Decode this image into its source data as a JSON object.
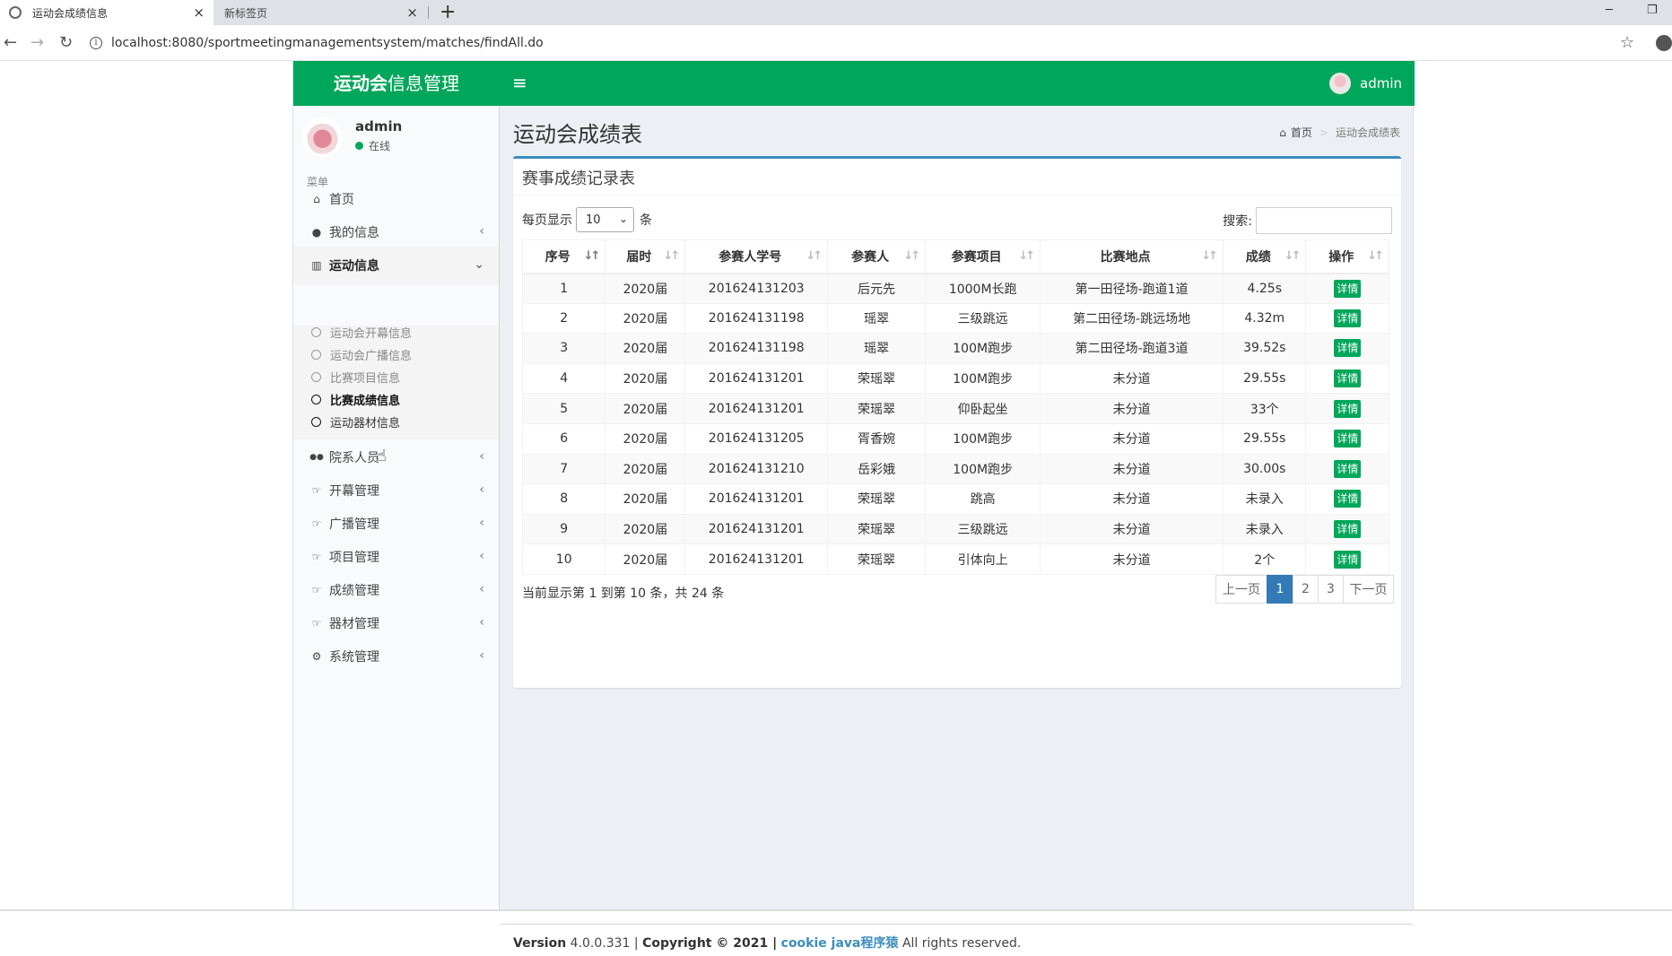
{
  "browser": {
    "tabs": [
      {
        "title": "运动会成绩信息",
        "close": "×"
      },
      {
        "title": "新标签页",
        "close": "×"
      }
    ],
    "new_tab": "+",
    "url": "localhost:8080/sportmeetingmanagementsystem/matches/findAll.do",
    "back": "←",
    "forward": "→",
    "reload": "↻",
    "star": "☆",
    "info": "i",
    "win_min": "─",
    "win_restore": "❐"
  },
  "header": {
    "logo_bold": "运动会",
    "logo_rest": "信息管理",
    "menu_toggle": "≡",
    "username": "admin"
  },
  "sidebar": {
    "user_name": "admin",
    "user_status": "在线",
    "menu_header": "菜单",
    "items": [
      {
        "label": "首页",
        "icon": "⌂",
        "arrow": ""
      },
      {
        "label": "我的信息",
        "icon": "●",
        "arrow": "‹"
      },
      {
        "label": "运动信息",
        "icon": "▥",
        "arrow": "⌄"
      },
      {
        "label": "院系人员",
        "icon": "●●",
        "arrow": "‹"
      },
      {
        "label": "开幕管理",
        "icon": "☞",
        "arrow": "‹"
      },
      {
        "label": "广播管理",
        "icon": "☞",
        "arrow": "‹"
      },
      {
        "label": "项目管理",
        "icon": "☞",
        "arrow": "‹"
      },
      {
        "label": "成绩管理",
        "icon": "☞",
        "arrow": "‹"
      },
      {
        "label": "器材管理",
        "icon": "☞",
        "arrow": "‹"
      },
      {
        "label": "系统管理",
        "icon": "⚙",
        "arrow": "‹"
      }
    ],
    "submenu": [
      {
        "label": "运动会开幕信息"
      },
      {
        "label": "运动会广播信息"
      },
      {
        "label": "比赛项目信息"
      },
      {
        "label": "比赛成绩信息"
      },
      {
        "label": "运动器材信息"
      }
    ]
  },
  "content": {
    "page_title": "运动会成绩表",
    "breadcrumb": {
      "home_icon": "⌂",
      "home": "首页",
      "sep": ">",
      "current": "运动会成绩表"
    },
    "box_title": "赛事成绩记录表",
    "length_prefix": "每页显示",
    "length_value": "10",
    "length_caret": "⌄",
    "length_suffix": "条",
    "search_label": "搜索:",
    "columns": [
      "序号",
      "届时",
      "参赛人学号",
      "参赛人",
      "参赛项目",
      "比赛地点",
      "成绩",
      "操作"
    ],
    "sort_icon": "↓↑",
    "rows": [
      [
        "1",
        "2020届",
        "201624131203",
        "后元先",
        "1000M长跑",
        "第一田径场-跑道1道",
        "4.25s",
        "详情"
      ],
      [
        "2",
        "2020届",
        "201624131198",
        "瑶翠",
        "三级跳远",
        "第二田径场-跳远场地",
        "4.32m",
        "详情"
      ],
      [
        "3",
        "2020届",
        "201624131198",
        "瑶翠",
        "100M跑步",
        "第二田径场-跑道3道",
        "39.52s",
        "详情"
      ],
      [
        "4",
        "2020届",
        "201624131201",
        "荣瑶翠",
        "100M跑步",
        "未分道",
        "29.55s",
        "详情"
      ],
      [
        "5",
        "2020届",
        "201624131201",
        "荣瑶翠",
        "仰卧起坐",
        "未分道",
        "33个",
        "详情"
      ],
      [
        "6",
        "2020届",
        "201624131205",
        "胥香婉",
        "100M跑步",
        "未分道",
        "29.55s",
        "详情"
      ],
      [
        "7",
        "2020届",
        "201624131210",
        "岳彩娥",
        "100M跑步",
        "未分道",
        "30.00s",
        "详情"
      ],
      [
        "8",
        "2020届",
        "201624131201",
        "荣瑶翠",
        "跳高",
        "未分道",
        "未录入",
        "详情"
      ],
      [
        "9",
        "2020届",
        "201624131201",
        "荣瑶翠",
        "三级跳远",
        "未分道",
        "未录入",
        "详情"
      ],
      [
        "10",
        "2020届",
        "201624131201",
        "荣瑶翠",
        "引体向上",
        "未分道",
        "2个",
        "详情"
      ]
    ],
    "table_info": "当前显示第 1 到第 10 条，共 24 条",
    "pagination": {
      "prev": "上一页",
      "pages": [
        "1",
        "2",
        "3"
      ],
      "next": "下一页",
      "active_page": "1"
    }
  },
  "footer": {
    "version_label": "Version",
    "version": "4.0.0.331 |",
    "copyright": "Copyright © 2021 |",
    "link": "cookie java程序猿",
    "rights": "All rights reserved."
  },
  "colors": {
    "header": "#00a65a",
    "box_top": "#3c8dbc",
    "detail_button": "#00a65a",
    "active_page": "#337ab7"
  },
  "cursor": "☝"
}
